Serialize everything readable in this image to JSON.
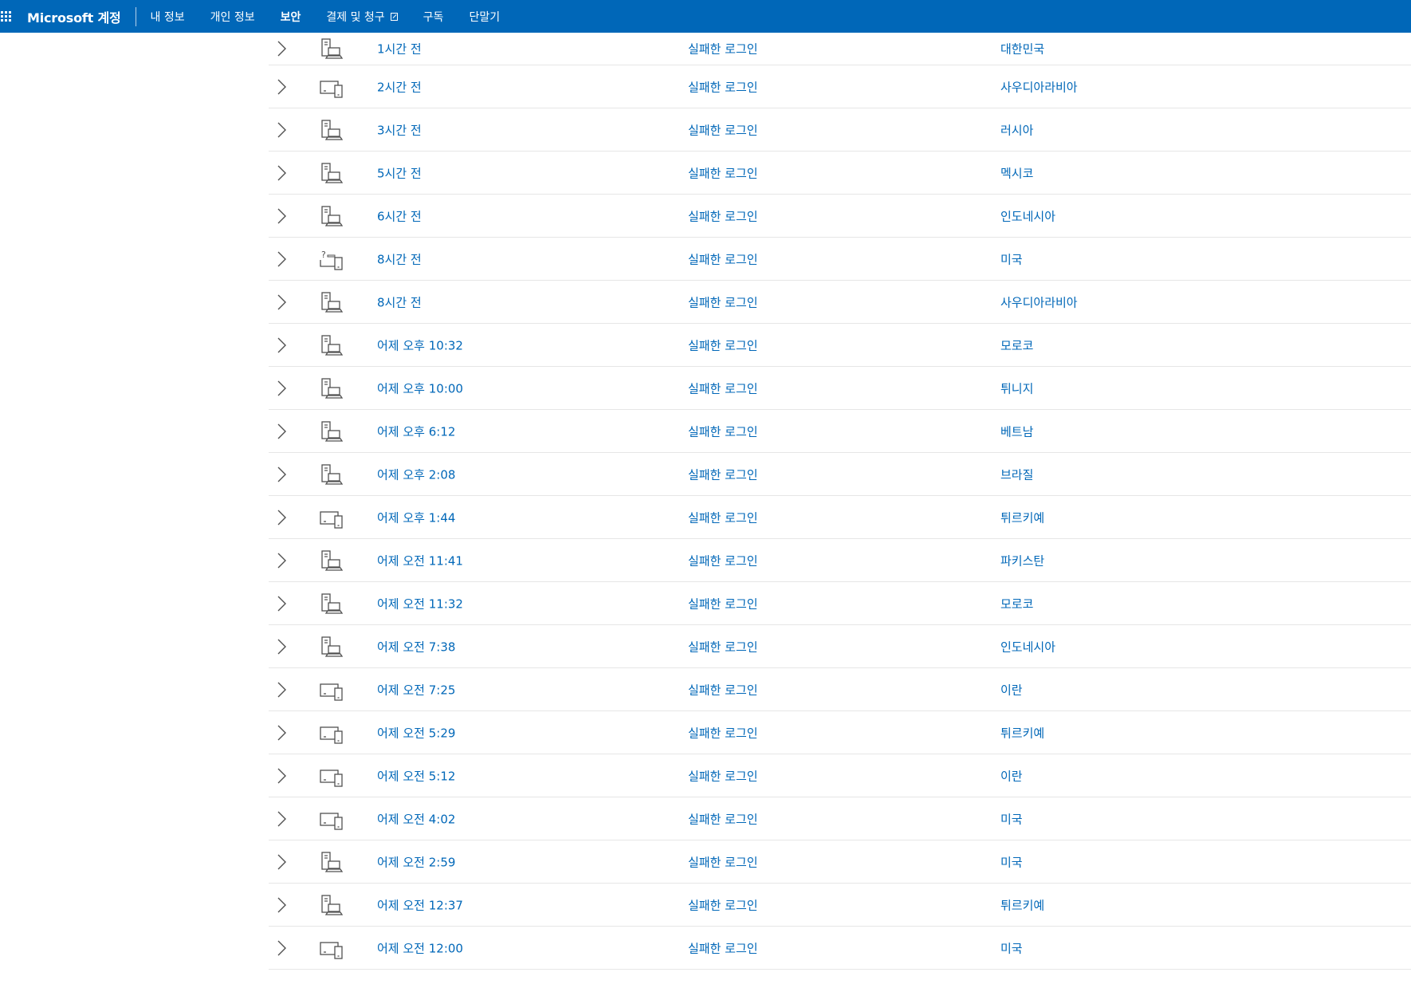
{
  "header": {
    "brand": "Microsoft 계정",
    "nav": [
      {
        "label": "내 정보",
        "active": false,
        "external": false
      },
      {
        "label": "개인 정보",
        "active": false,
        "external": false
      },
      {
        "label": "보안",
        "active": true,
        "external": false
      },
      {
        "label": "결제 및 청구",
        "active": false,
        "external": true
      },
      {
        "label": "구독",
        "active": false,
        "external": false
      },
      {
        "label": "단말기",
        "active": false,
        "external": false
      }
    ]
  },
  "activity": [
    {
      "time": "1시간 전",
      "status": "실패한 로그인",
      "location": "대한민국",
      "device_icon": "desktop-laptop-icon"
    },
    {
      "time": "2시간 전",
      "status": "실패한 로그인",
      "location": "사우디아라비아",
      "device_icon": "monitor-phone-icon"
    },
    {
      "time": "3시간 전",
      "status": "실패한 로그인",
      "location": "러시아",
      "device_icon": "desktop-laptop-icon"
    },
    {
      "time": "5시간 전",
      "status": "실패한 로그인",
      "location": "멕시코",
      "device_icon": "desktop-laptop-icon"
    },
    {
      "time": "6시간 전",
      "status": "실패한 로그인",
      "location": "인도네시아",
      "device_icon": "desktop-laptop-icon"
    },
    {
      "time": "8시간 전",
      "status": "실패한 로그인",
      "location": "미국",
      "device_icon": "unknown-device-icon"
    },
    {
      "time": "8시간 전",
      "status": "실패한 로그인",
      "location": "사우디아라비아",
      "device_icon": "desktop-laptop-icon"
    },
    {
      "time": "어제 오후 10:32",
      "status": "실패한 로그인",
      "location": "모로코",
      "device_icon": "desktop-laptop-icon"
    },
    {
      "time": "어제 오후 10:00",
      "status": "실패한 로그인",
      "location": "튀니지",
      "device_icon": "desktop-laptop-icon"
    },
    {
      "time": "어제 오후 6:12",
      "status": "실패한 로그인",
      "location": "베트남",
      "device_icon": "desktop-laptop-icon"
    },
    {
      "time": "어제 오후 2:08",
      "status": "실패한 로그인",
      "location": "브라질",
      "device_icon": "desktop-laptop-icon"
    },
    {
      "time": "어제 오후 1:44",
      "status": "실패한 로그인",
      "location": "튀르키예",
      "device_icon": "monitor-phone-icon"
    },
    {
      "time": "어제 오전 11:41",
      "status": "실패한 로그인",
      "location": "파키스탄",
      "device_icon": "desktop-laptop-icon"
    },
    {
      "time": "어제 오전 11:32",
      "status": "실패한 로그인",
      "location": "모로코",
      "device_icon": "desktop-laptop-icon"
    },
    {
      "time": "어제 오전 7:38",
      "status": "실패한 로그인",
      "location": "인도네시아",
      "device_icon": "desktop-laptop-icon"
    },
    {
      "time": "어제 오전 7:25",
      "status": "실패한 로그인",
      "location": "이란",
      "device_icon": "monitor-phone-icon"
    },
    {
      "time": "어제 오전 5:29",
      "status": "실패한 로그인",
      "location": "튀르키예",
      "device_icon": "monitor-phone-icon"
    },
    {
      "time": "어제 오전 5:12",
      "status": "실패한 로그인",
      "location": "이란",
      "device_icon": "monitor-phone-icon"
    },
    {
      "time": "어제 오전 4:02",
      "status": "실패한 로그인",
      "location": "미국",
      "device_icon": "monitor-phone-icon"
    },
    {
      "time": "어제 오전 2:59",
      "status": "실패한 로그인",
      "location": "미국",
      "device_icon": "desktop-laptop-icon"
    },
    {
      "time": "어제 오전 12:37",
      "status": "실패한 로그인",
      "location": "튀르키예",
      "device_icon": "desktop-laptop-icon"
    },
    {
      "time": "어제 오전 12:00",
      "status": "실패한 로그인",
      "location": "미국",
      "device_icon": "monitor-phone-icon"
    }
  ],
  "colors": {
    "header_bg": "#0067b8",
    "link": "#0067b8",
    "icon": "#505050",
    "row_border": "#e6e6e6"
  }
}
